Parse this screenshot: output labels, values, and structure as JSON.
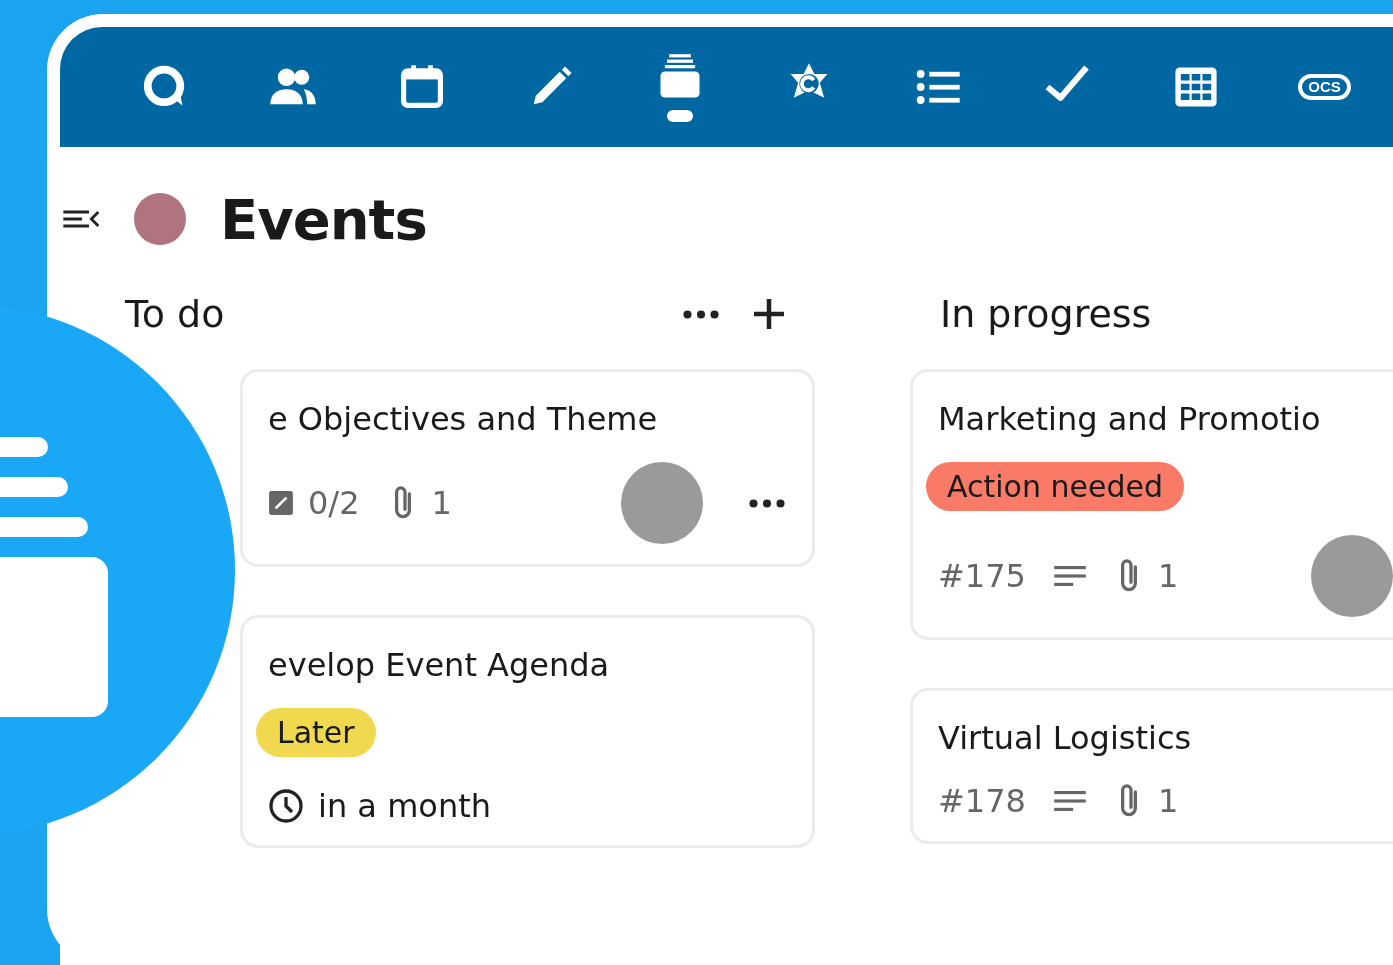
{
  "apps": [
    {
      "kind": "talk",
      "selected": false
    },
    {
      "kind": "contacts",
      "selected": false
    },
    {
      "kind": "calendar",
      "selected": false
    },
    {
      "kind": "notes",
      "selected": false
    },
    {
      "kind": "deck",
      "selected": true
    },
    {
      "kind": "collectives",
      "selected": false
    },
    {
      "kind": "list",
      "selected": false
    },
    {
      "kind": "tasks",
      "selected": false
    },
    {
      "kind": "tables",
      "selected": false
    },
    {
      "kind": "ocs",
      "label": "OCS",
      "selected": false
    }
  ],
  "board": {
    "title": "Events",
    "color": "#b0747e"
  },
  "columns": [
    {
      "title": "To do",
      "actions": true,
      "cards": [
        {
          "title": "e Objectives and Theme",
          "checklist": "0/2",
          "attachments": "1",
          "assigned": true,
          "menu": true
        },
        {
          "title": "evelop Event Agenda",
          "tag": {
            "label": "Later",
            "color": "#f0d94f"
          },
          "due": "in a month"
        }
      ]
    },
    {
      "title": "In progress",
      "actions": false,
      "cards": [
        {
          "title": "Marketing and Promotio",
          "tag": {
            "label": "Action needed",
            "color": "#fa7a68"
          },
          "number": "#175",
          "description": true,
          "attachments": "1",
          "assigned": true
        },
        {
          "title": "Virtual Logistics",
          "number": "#178",
          "description": true,
          "attachments": "1"
        }
      ]
    }
  ]
}
